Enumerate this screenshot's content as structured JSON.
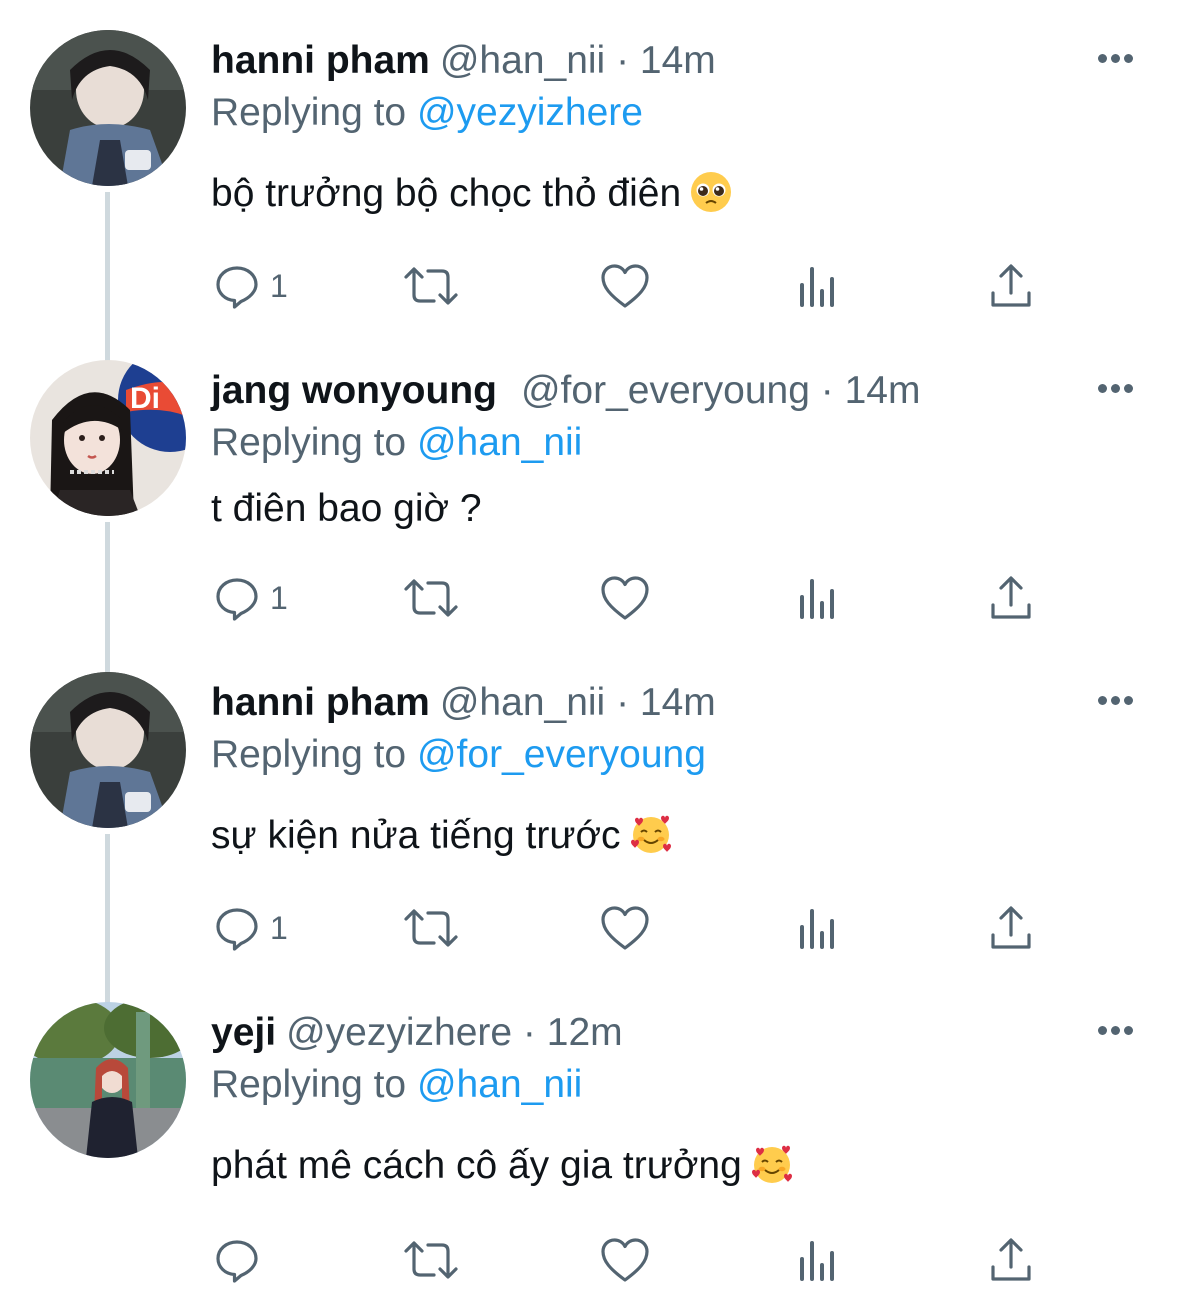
{
  "tweets": [
    {
      "name": "hanni pham",
      "handle": "@han_nii",
      "sep": "·",
      "time": "14m",
      "replying_prefix": "Replying to",
      "replying_to": "@yezyizhere",
      "text": "bộ trưởng bộ chọc thỏ điên",
      "emoji": "pleading-face-emoji",
      "reply_count": "1"
    },
    {
      "name": "jang wonyoung",
      "handle": "@for_everyoung",
      "sep": "·",
      "time": "14m",
      "replying_prefix": "Replying to",
      "replying_to": "@han_nii",
      "text": "t điên bao giờ ?",
      "emoji": "",
      "reply_count": "1"
    },
    {
      "name": "hanni pham",
      "handle": "@han_nii",
      "sep": "·",
      "time": "14m",
      "replying_prefix": "Replying to",
      "replying_to": "@for_everyoung",
      "text": "sự kiện nửa tiếng trước",
      "emoji": "smiling-face-with-hearts-emoji",
      "reply_count": "1"
    },
    {
      "name": "yeji",
      "handle": "@yezyizhere",
      "sep": "·",
      "time": "12m",
      "replying_prefix": "Replying to",
      "replying_to": "@han_nii",
      "text": "phát mê cách cô ấy gia trưởng",
      "emoji": "smiling-face-with-hearts-emoji",
      "reply_count": ""
    }
  ],
  "colors": {
    "text": "#0f1419",
    "secondary": "#536471",
    "link": "#1d9bf0",
    "thread_line": "#cfd9de"
  },
  "icons": [
    "reply-icon",
    "retweet-icon",
    "like-icon",
    "views-icon",
    "share-icon",
    "more-icon"
  ]
}
